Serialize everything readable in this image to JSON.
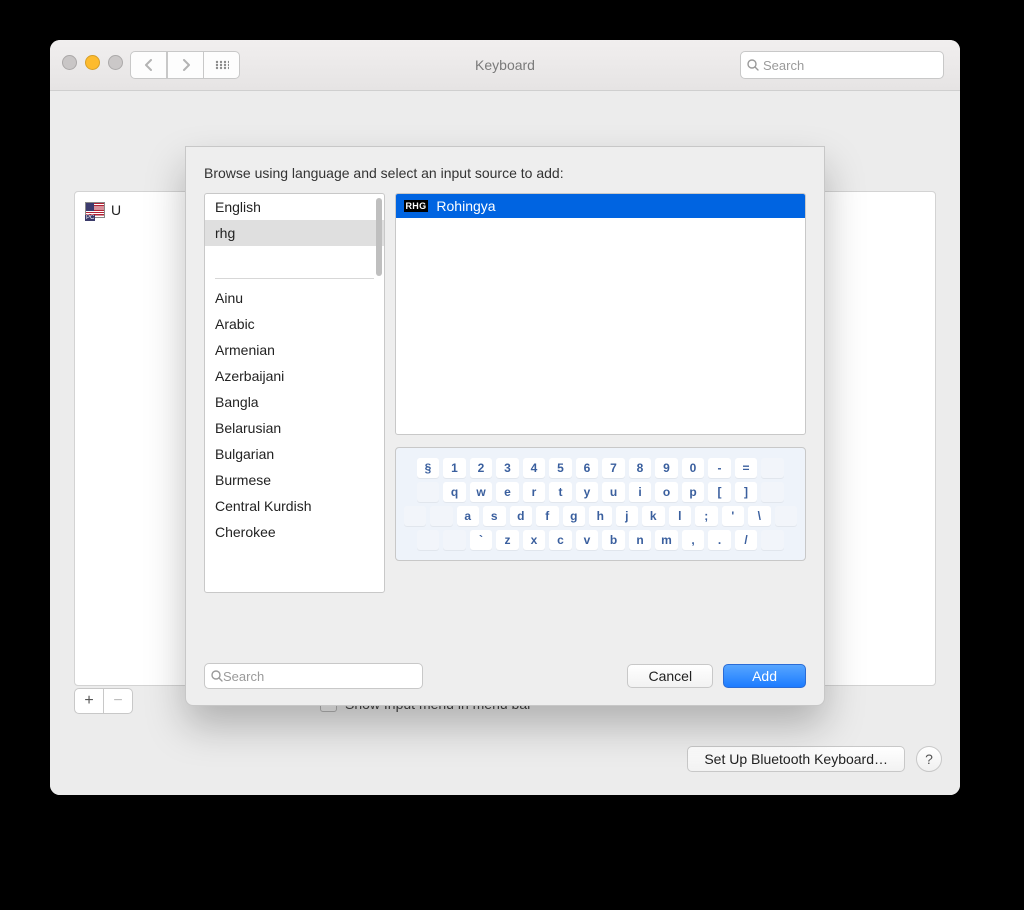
{
  "window": {
    "title": "Keyboard",
    "search_placeholder": "Search"
  },
  "background": {
    "input_source_label": "U",
    "add_symbol": "+",
    "remove_symbol": "−",
    "show_input_menu_label": "Show Input menu in menu bar",
    "bluetooth_button": "Set Up Bluetooth Keyboard…",
    "help_label": "?"
  },
  "sheet": {
    "heading": "Browse using language and select an input source to add:",
    "top_languages": [
      "English",
      "rhg"
    ],
    "selected_language_index": 1,
    "languages": [
      "Ainu",
      "Arabic",
      "Armenian",
      "Azerbaijani",
      "Bangla",
      "Belarusian",
      "Bulgarian",
      "Burmese",
      "Central Kurdish",
      "Cherokee"
    ],
    "source_badge": "RHG",
    "source_name": "Rohingya",
    "keyboard_rows": [
      [
        "§",
        "1",
        "2",
        "3",
        "4",
        "5",
        "6",
        "7",
        "8",
        "9",
        "0",
        "-",
        "="
      ],
      [
        "q",
        "w",
        "e",
        "r",
        "t",
        "y",
        "u",
        "i",
        "o",
        "p",
        "[",
        "]"
      ],
      [
        "a",
        "s",
        "d",
        "f",
        "g",
        "h",
        "j",
        "k",
        "l",
        ";",
        "'",
        "\\"
      ],
      [
        "`",
        "z",
        "x",
        "c",
        "v",
        "b",
        "n",
        "m",
        ",",
        ".",
        "/"
      ]
    ],
    "search_placeholder": "Search",
    "cancel_label": "Cancel",
    "add_label": "Add"
  }
}
